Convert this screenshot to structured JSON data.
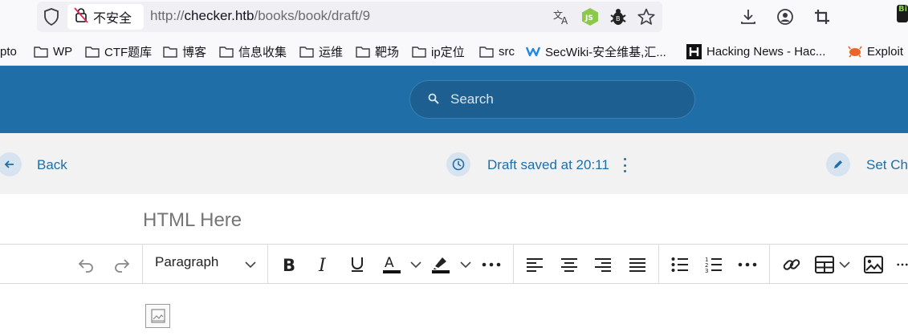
{
  "browser": {
    "url_prefix": "http://",
    "url_host": "checker.htb",
    "url_path": "/books/book/draft/9",
    "security_label": "不安全",
    "extension_badge": "Bi"
  },
  "bookmarks": [
    {
      "label": "pto",
      "type": "text"
    },
    {
      "label": "WP",
      "type": "folder"
    },
    {
      "label": "CTF题库",
      "type": "folder"
    },
    {
      "label": "博客",
      "type": "folder"
    },
    {
      "label": "信息收集",
      "type": "folder"
    },
    {
      "label": "运维",
      "type": "folder"
    },
    {
      "label": "靶场",
      "type": "folder"
    },
    {
      "label": "ip定位",
      "type": "folder"
    },
    {
      "label": "src",
      "type": "folder"
    },
    {
      "label": "SecWiki-安全维基,汇...",
      "type": "site"
    },
    {
      "label": "Hacking News - Hac...",
      "type": "site"
    },
    {
      "label": "Exploit",
      "type": "site"
    }
  ],
  "header": {
    "search_placeholder": "Search"
  },
  "actions": {
    "back_label": "Back",
    "draft_status": "Draft saved at 20:11",
    "set_chapter_label": "Set Ch"
  },
  "editor": {
    "title_placeholder": "HTML Here",
    "block_format": "Paragraph"
  },
  "colors": {
    "brand": "#206ea7",
    "header_search": "#1d5f90",
    "action_bar": "#f2f2f2"
  }
}
